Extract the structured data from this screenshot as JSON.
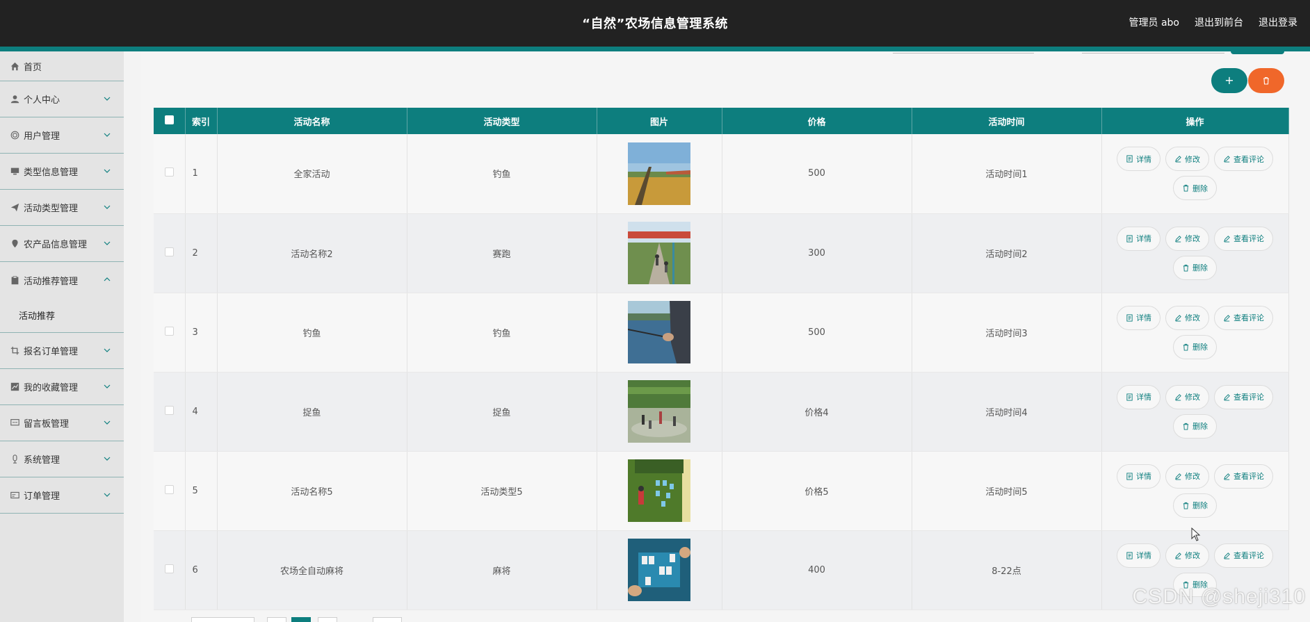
{
  "header": {
    "title": "“自然”农场信息管理系统",
    "admin_label": "管理员 abo",
    "front_label": "退出到前台",
    "logout_label": "退出登录"
  },
  "sidebar": {
    "items": [
      {
        "label": "首页",
        "icon": "home-icon"
      },
      {
        "label": "个人中心",
        "icon": "user-icon"
      },
      {
        "label": "用户管理",
        "icon": "target-icon"
      },
      {
        "label": "类型信息管理",
        "icon": "monitor-icon"
      },
      {
        "label": "活动类型管理",
        "icon": "send-icon"
      },
      {
        "label": "农产品信息管理",
        "icon": "location-icon"
      },
      {
        "label": "活动推荐管理",
        "icon": "clipboard-icon"
      },
      {
        "label": "报名订单管理",
        "icon": "crop-icon"
      },
      {
        "label": "我的收藏管理",
        "icon": "chart-icon"
      },
      {
        "label": "留言板管理",
        "icon": "message-icon"
      },
      {
        "label": "系统管理",
        "icon": "mic-icon"
      },
      {
        "label": "订单管理",
        "icon": "card-icon"
      }
    ],
    "sub_item": "活动推荐"
  },
  "table": {
    "headers": [
      "索引",
      "活动名称",
      "活动类型",
      "图片",
      "价格",
      "活动时间",
      "操作"
    ],
    "rows": [
      {
        "index": "1",
        "name": "全家活动",
        "type": "钓鱼",
        "price": "500",
        "time": "活动时间1"
      },
      {
        "index": "2",
        "name": "活动名称2",
        "type": "赛跑",
        "price": "300",
        "time": "活动时间2"
      },
      {
        "index": "3",
        "name": "钓鱼",
        "type": "钓鱼",
        "price": "500",
        "time": "活动时间3"
      },
      {
        "index": "4",
        "name": "捉鱼",
        "type": "捉鱼",
        "price": "价格4",
        "time": "活动时间4"
      },
      {
        "index": "5",
        "name": "活动名称5",
        "type": "活动类型5",
        "price": "价格5",
        "time": "活动时间5"
      },
      {
        "index": "6",
        "name": "农场全自动麻将",
        "type": "麻将",
        "price": "400",
        "time": "8-22点"
      }
    ],
    "actions": {
      "detail": "详情",
      "edit": "修改",
      "comments": "查看评论",
      "delete": "删除"
    }
  },
  "buttons": {
    "add": "+"
  },
  "watermark": "CSDN @sheji310",
  "colors": {
    "header_bg": "#222222",
    "accent": "#0d7e7e",
    "delete": "#f0672a"
  }
}
